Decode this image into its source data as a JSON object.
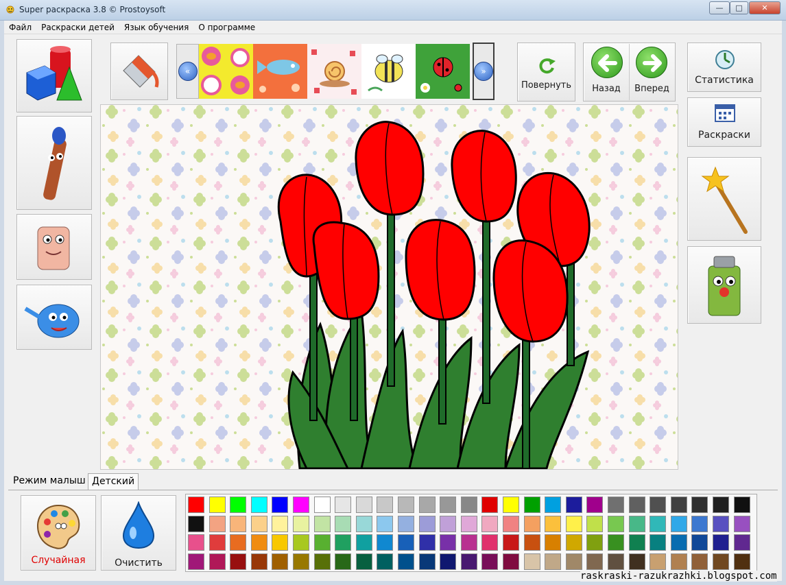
{
  "window": {
    "title": "Super раскраска 3.8 © Prostoysoft",
    "controls": {
      "minimize": "—",
      "maximize": "□",
      "close": "✕"
    }
  },
  "menu": {
    "items": [
      "Файл",
      "Раскраски детей",
      "Язык обучения",
      "О программе"
    ]
  },
  "toolbar": {
    "rotate_label": "Повернуть",
    "back_label": "Назад",
    "forward_label": "Вперед",
    "thumbnails": [
      "birds-pattern",
      "fish-pattern",
      "snail-pattern",
      "bees-pattern",
      "ladybug-pattern"
    ]
  },
  "right_panel": {
    "stats_label": "Статистика",
    "coloring_label": "Раскраски"
  },
  "tabs": {
    "baby_mode": "Режим малыш",
    "child_mode": "Детский"
  },
  "bottom": {
    "random_label": "Случайная",
    "clear_label": "Очистить"
  },
  "colors": {
    "accent_red": "#e00000",
    "tulip_red": "#ff0000",
    "leaf_green": "#2f7f2f",
    "stem_green": "#1f6b2a",
    "palette_rows": [
      [
        "#ff0000",
        "#ffff00",
        "#00ff00",
        "#00ffff",
        "#0000ff",
        "#ff00ff",
        "#ffffff",
        "#e6e6e6",
        "#d9d9d9",
        "#c8c8c8",
        "#b8b8b8",
        "#a8a8a8",
        "#989898",
        "#888888",
        "#e00000",
        "#ffff00",
        "#00a000",
        "#00a0e0",
        "#1c1c9c",
        "#a0008c",
        "#707070",
        "#606060",
        "#505050",
        "#404040",
        "#303030",
        "#202020",
        "#101010"
      ],
      [
        "#111111",
        "#f3a382",
        "#f8b57a",
        "#fbd08a",
        "#fff29c",
        "#e8f2a0",
        "#c2e4a4",
        "#a8dcb4",
        "#98d8d8",
        "#8cc8ee",
        "#94b0e0",
        "#9c9cd8",
        "#c0a0d8",
        "#e0a8d8",
        "#f0a8c0",
        "#f08282",
        "#f4a060",
        "#fbc03c",
        "#fff04a",
        "#c0e04a",
        "#78c850",
        "#48b888",
        "#30b8b8",
        "#30a8e8",
        "#3c78d0",
        "#5850c0",
        "#9850c0"
      ],
      [
        "#e8508c",
        "#e03c3c",
        "#e86c20",
        "#f08c10",
        "#f8c800",
        "#a8c820",
        "#58b030",
        "#20a060",
        "#10a0a0",
        "#1088d0",
        "#1860b8",
        "#3030a8",
        "#7830a8",
        "#b83090",
        "#e0306c",
        "#c81818",
        "#c85010",
        "#d88000",
        "#d0a800",
        "#80a010",
        "#389020",
        "#108050",
        "#088080",
        "#086cb0",
        "#104898",
        "#202090",
        "#602890"
      ],
      [
        "#a01878",
        "#b01858",
        "#981010",
        "#983808",
        "#a06000",
        "#987800",
        "#587008",
        "#286818",
        "#086040",
        "#006060",
        "#00508c",
        "#083878",
        "#101870",
        "#481870",
        "#780e58",
        "#800c40",
        "#d8c4a8",
        "#c0a888",
        "#a08868",
        "#806850",
        "#605040",
        "#403020",
        "#c8a070",
        "#b08050",
        "#906038",
        "#704820",
        "#503010"
      ]
    ]
  }
}
